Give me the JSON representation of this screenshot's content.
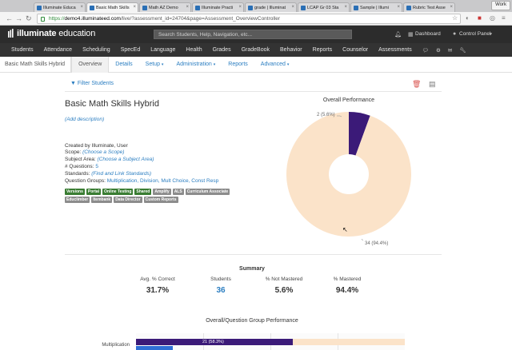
{
  "browser": {
    "tabs": [
      {
        "label": "Illuminate Educa",
        "active": false
      },
      {
        "label": "Basic Math Skills",
        "active": true
      },
      {
        "label": "Math AZ Demo",
        "active": false
      },
      {
        "label": "Illuminate Practi",
        "active": false
      },
      {
        "label": "grade | Illuminat",
        "active": false
      },
      {
        "label": "LCAP Gr 03 Sta",
        "active": false
      },
      {
        "label": "Sample | Illumi",
        "active": false
      },
      {
        "label": "Rubric Test Asse",
        "active": false
      }
    ],
    "profile_button": "Work",
    "url_scheme": "https://",
    "url_host": "demo4.illuminateed.com",
    "url_path": "/live/?assessment_id=24704&page=Assessment_OverviewController"
  },
  "app": {
    "logo_brand": "illuminate",
    "logo_suffix": " education",
    "search_placeholder": "Search Students, Help, Navigation, etc...",
    "dashboard_label": "Dashboard",
    "control_panel_label": "Control Panel"
  },
  "main_nav": [
    "Students",
    "Attendance",
    "Scheduling",
    "SpecEd",
    "Language",
    "Health",
    "Grades",
    "GradeBook",
    "Behavior",
    "Reports",
    "Counselor",
    "Assessments"
  ],
  "sub_nav": {
    "title": "Basic Math Skills Hybrid",
    "tabs": [
      "Overview",
      "Details",
      "Setup",
      "Administration",
      "Reports",
      "Advanced"
    ]
  },
  "content": {
    "filter_label": "Filter Students",
    "assessment_title": "Basic Math Skills Hybrid",
    "add_description": "(Add description)",
    "created_by": "Created by Illuminate, User",
    "scope_label": "Scope:",
    "scope_value": "(Choose a Scope)",
    "subject_label": "Subject Area:",
    "subject_value": "(Choose a Subject Area)",
    "questions_label": "# Questions:",
    "questions_value": "5",
    "standards_label": "Standards:",
    "standards_value": "(Find and Link Standards)",
    "groups_label": "Question Groups:",
    "groups_value": "Multiplication, Division, Mult Choice, Const Resp",
    "tags": [
      {
        "label": "Versions",
        "color": "#3a7d33"
      },
      {
        "label": "Portal",
        "color": "#3a7d33"
      },
      {
        "label": "Online Testing",
        "color": "#3a7d33"
      },
      {
        "label": "Shared",
        "color": "#3a7d33"
      },
      {
        "label": "Amplify",
        "color": "#8c8c8c"
      },
      {
        "label": "ALS",
        "color": "#8c8c8c"
      },
      {
        "label": "Curriculum Associate",
        "color": "#8c8c8c"
      },
      {
        "label": "Educlimber",
        "color": "#8c8c8c"
      },
      {
        "label": "Itembank",
        "color": "#8c8c8c"
      },
      {
        "label": "Data Director",
        "color": "#8c8c8c"
      },
      {
        "label": "Custom Reports",
        "color": "#8c8c8c"
      }
    ]
  },
  "chart_data": [
    {
      "type": "pie",
      "title": "Overall Performance",
      "slices": [
        {
          "label": "2 (5.6%)",
          "count": 2,
          "percent": 5.6,
          "color": "#3b1a78"
        },
        {
          "label": "34 (94.4%)",
          "count": 34,
          "percent": 94.4,
          "color": "#fbe3c9"
        }
      ]
    },
    {
      "type": "bar",
      "title": "Overall/Question Group Performance",
      "categories": [
        "Multiplication"
      ],
      "series": [
        {
          "values": [
            58.3
          ],
          "label": "21 (58.3%)",
          "color": "#3b1a78"
        },
        {
          "values": [
            41.7
          ],
          "color": "#fbe3c9"
        }
      ]
    }
  ],
  "summary": {
    "title": "Summary",
    "stats": [
      {
        "label": "Avg. % Correct",
        "value": "31.7%"
      },
      {
        "label": "Students",
        "value": "36"
      },
      {
        "label": "% Not Mastered",
        "value": "5.6%"
      },
      {
        "label": "% Mastered",
        "value": "94.4%"
      }
    ]
  }
}
